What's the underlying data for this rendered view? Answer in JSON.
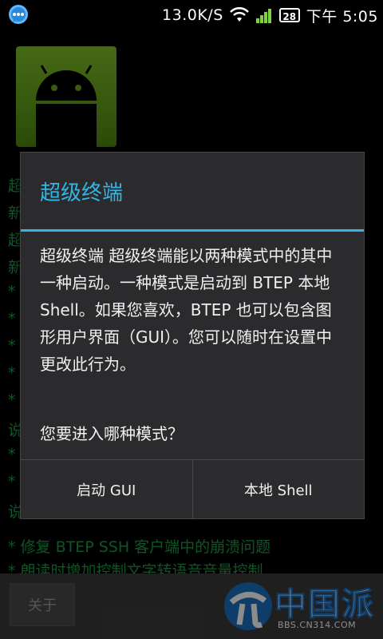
{
  "statusbar": {
    "app_icon": "chat-bubble-icon",
    "net_speed": "13.0K/S",
    "wifi_icon": "wifi-icon",
    "signal_icon": "signal-icon",
    "battery": "28",
    "time": "下午 5:05"
  },
  "background": {
    "app_icon": "android-icon",
    "lines": [
      "超",
      "新",
      "超",
      "新",
      "*",
      "*",
      "*",
      "*",
      "*",
      "说",
      "*",
      "*",
      "说"
    ],
    "bottom_lines": [
      "* 修复 BTEP SSH 客户端中的崩溃问题",
      "* 朗读时增加控制文字转语音音量控制"
    ]
  },
  "bottombar": {
    "about_label": "关于",
    "watermark_text": "中国派",
    "watermark_url": "BBS.CN314.COM"
  },
  "dialog": {
    "title": "超级终端",
    "message": "超级终端 超级终端能以两种模式中的其中一种启动。一种模式是启动到 BTEP 本地 Shell。如果您喜欢，BTEP 也可以包含图形用户界面（GUI）。您可以随时在设置中更改此行为。",
    "question": "您要进入哪种模式？",
    "btn_gui": "启动 GUI",
    "btn_shell": "本地 Shell"
  },
  "colors": {
    "accent": "#33b5e5",
    "dialog_bg": "#2b2b2d",
    "terminal_green": "#1fa34a"
  }
}
